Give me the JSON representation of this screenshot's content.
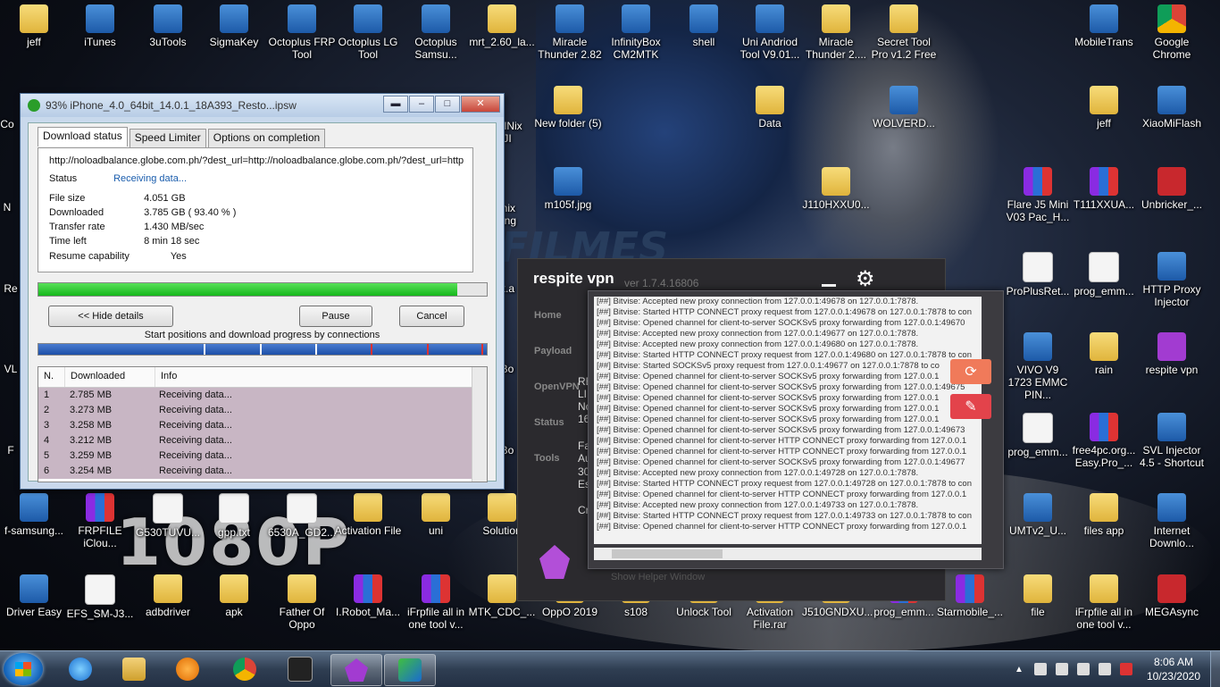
{
  "desktop": {
    "icons": [
      {
        "label": "jeff",
        "type": "folder"
      },
      {
        "label": "iTunes",
        "type": "app"
      },
      {
        "label": "3uTools",
        "type": "app"
      },
      {
        "label": "SigmaKey",
        "type": "app"
      },
      {
        "label": "Octoplus FRP Tool",
        "type": "app"
      },
      {
        "label": "Octoplus LG Tool",
        "type": "app"
      },
      {
        "label": "Octoplus Samsu...",
        "type": "app"
      },
      {
        "label": "mrt_2.60_la...",
        "type": "folder"
      },
      {
        "label": "Miracle Thunder 2.82",
        "type": "app"
      },
      {
        "label": "InfinityBox CM2MTK",
        "type": "app"
      },
      {
        "label": "shell",
        "type": "app"
      },
      {
        "label": "Uni Andriod Tool V9.01...",
        "type": "app"
      },
      {
        "label": "Miracle Thunder 2....",
        "type": "folder"
      },
      {
        "label": "Secret Tool Pro v1.2 Free",
        "type": "folder"
      },
      {
        "label": "MobileTrans",
        "type": "app"
      },
      {
        "label": "Google Chrome",
        "type": "chrome"
      },
      {
        "label": "New folder (5)",
        "type": "folder"
      },
      {
        "label": "Data",
        "type": "folder"
      },
      {
        "label": "WOLVERD...",
        "type": "app"
      },
      {
        "label": "jeff",
        "type": "folder"
      },
      {
        "label": "XiaoMiFlash",
        "type": "app"
      },
      {
        "label": "m105f.jpg",
        "type": "image"
      },
      {
        "label": "J110HXXU0...",
        "type": "folder"
      },
      {
        "label": "Flare J5 Mini V03 Pac_H...",
        "type": "rar"
      },
      {
        "label": "T111XXUA...",
        "type": "rar"
      },
      {
        "label": "Unbricker_...",
        "type": "red"
      },
      {
        "label": "ProPlusRet...",
        "type": "doc"
      },
      {
        "label": "prog_emm...",
        "type": "doc"
      },
      {
        "label": "HTTP Proxy Injector",
        "type": "app"
      },
      {
        "label": "VIVO V9 1723 EMMC PIN...",
        "type": "app"
      },
      {
        "label": "rain",
        "type": "folder"
      },
      {
        "label": "respite vpn",
        "type": "purple"
      },
      {
        "label": "prog_emm...",
        "type": "doc"
      },
      {
        "label": "free4pc.org... Easy.Pro_...",
        "type": "rar"
      },
      {
        "label": "SVL Injector 4.5 - Shortcut",
        "type": "app"
      },
      {
        "label": "f-samsung...",
        "type": "app"
      },
      {
        "label": "FRPFILE iClou...",
        "type": "rar"
      },
      {
        "label": "G530TUVU...",
        "type": "doc"
      },
      {
        "label": "gpp.txt",
        "type": "doc"
      },
      {
        "label": "6530A_GD2...",
        "type": "doc"
      },
      {
        "label": "Activation File",
        "type": "folder"
      },
      {
        "label": "uni",
        "type": "folder"
      },
      {
        "label": "Solution",
        "type": "folder"
      },
      {
        "label": "UMTv2_U...",
        "type": "app"
      },
      {
        "label": "files app",
        "type": "folder"
      },
      {
        "label": "Internet Downlo...",
        "type": "app"
      },
      {
        "label": "Driver Easy",
        "type": "app"
      },
      {
        "label": "EFS_SM-J3...",
        "type": "doc"
      },
      {
        "label": "adbdriver",
        "type": "folder"
      },
      {
        "label": "apk",
        "type": "folder"
      },
      {
        "label": "Father Of Oppo",
        "type": "folder"
      },
      {
        "label": "I.Robot_Ma...",
        "type": "rar"
      },
      {
        "label": "iFrpfile all in one tool v...",
        "type": "rar"
      },
      {
        "label": "MTK_CDC_...",
        "type": "folder"
      },
      {
        "label": "OppO 2019",
        "type": "folder"
      },
      {
        "label": "s108",
        "type": "folder"
      },
      {
        "label": "Unlock Tool",
        "type": "folder"
      },
      {
        "label": "Activation File.rar",
        "type": "folder"
      },
      {
        "label": "J510GNDXU...",
        "type": "folder"
      },
      {
        "label": "prog_emm...",
        "type": "rar"
      },
      {
        "label": "Starmobile_...",
        "type": "rar"
      },
      {
        "label": "file",
        "type": "folder"
      },
      {
        "label": "iFrpfile all in one tool v...",
        "type": "folder"
      },
      {
        "label": "MEGAsync",
        "type": "red"
      }
    ],
    "partial_labels": [
      "Co",
      "N",
      "Re",
      "VL",
      "F",
      "oolNix JI",
      "inix ang",
      "k.a",
      "Bo",
      "Bo"
    ]
  },
  "wallpaper": {
    "text1": "1080P",
    "text2": "FILMES"
  },
  "download_window": {
    "title": "93% iPhone_4.0_64bit_14.0.1_18A393_Resto...ipsw",
    "tabs": [
      "Download status",
      "Speed Limiter",
      "Options on completion"
    ],
    "url": "http://noloadbalance.globe.com.ph/?dest_url=http://noloadbalance.globe.com.ph/?dest_url=http",
    "status_label": "Status",
    "status_value": "Receiving data...",
    "file_size_label": "File size",
    "file_size": "4.051  GB",
    "downloaded_label": "Downloaded",
    "downloaded": "3.785  GB  ( 93.40 % )",
    "transfer_rate_label": "Transfer rate",
    "transfer_rate": "1.430  MB/sec",
    "time_left_label": "Time left",
    "time_left": "8 min 18 sec",
    "resume_label": "Resume capability",
    "resume": "Yes",
    "progress_percent": 93.4,
    "hide_details": "<< Hide details",
    "pause": "Pause",
    "cancel": "Cancel",
    "connections_label": "Start positions and download progress by connections",
    "columns": [
      "N.",
      "Downloaded",
      "Info"
    ],
    "rows": [
      {
        "n": "1",
        "dl": "2.785  MB",
        "info": "Receiving data..."
      },
      {
        "n": "2",
        "dl": "3.273  MB",
        "info": "Receiving data..."
      },
      {
        "n": "3",
        "dl": "3.258  MB",
        "info": "Receiving data..."
      },
      {
        "n": "4",
        "dl": "3.212  MB",
        "info": "Receiving data..."
      },
      {
        "n": "5",
        "dl": "3.259  MB",
        "info": "Receiving data..."
      },
      {
        "n": "6",
        "dl": "3.254  MB",
        "info": "Receiving data..."
      }
    ]
  },
  "vpn": {
    "title": "respite vpn",
    "version": "ver 1.7.4.16806",
    "nav": [
      "Home",
      "Payload",
      "OpenVPN",
      "Status",
      "Tools"
    ],
    "partial_text": [
      "RE",
      "LIF",
      "Nc",
      "16",
      "Fas",
      "Au",
      "30",
      "Est",
      "Cre"
    ],
    "helper": "Show Helper Window",
    "log_lines": [
      "[##] Bitvise: Accepted new proxy connection from 127.0.0.1:49678 on 127.0.0.1:7878.",
      "[##] Bitvise: Started HTTP CONNECT proxy request from 127.0.0.1:49678 on 127.0.0.1:7878 to con",
      "[##] Bitvise: Opened channel for client-to-server SOCKSv5 proxy forwarding from 127.0.0.1:49670",
      "[##] Bitvise: Accepted new proxy connection from 127.0.0.1:49677 on 127.0.0.1:7878.",
      "[##] Bitvise: Accepted new proxy connection from 127.0.0.1:49680 on 127.0.0.1:7878.",
      "[##] Bitvise: Started HTTP CONNECT proxy request from 127.0.0.1:49680 on 127.0.0.1:7878 to con",
      "[##] Bitvise: Started SOCKSv5 proxy request from 127.0.0.1:49677 on 127.0.0.1:7878 to co",
      "[##] Bitvise: Opened channel for client-to-server SOCKSv5 proxy forwarding from 127.0.0.1",
      "[##] Bitvise: Opened channel for client-to-server SOCKSv5 proxy forwarding from 127.0.0.1:49675",
      "[##] Bitvise: Opened channel for client-to-server SOCKSv5 proxy forwarding from 127.0.0.1",
      "[##] Bitvise: Opened channel for client-to-server SOCKSv5 proxy forwarding from 127.0.0.1",
      "[##] Bitvise: Opened channel for client-to-server SOCKSv5 proxy forwarding from 127.0.0.1",
      "[##] Bitvise: Opened channel for client-to-server SOCKSv5 proxy forwarding from 127.0.0.1:49673",
      "[##] Bitvise: Opened channel for client-to-server HTTP CONNECT proxy forwarding from 127.0.0.1",
      "[##] Bitvise: Opened channel for client-to-server HTTP CONNECT proxy forwarding from 127.0.0.1",
      "[##] Bitvise: Opened channel for client-to-server SOCKSv5 proxy forwarding from 127.0.0.1:49677",
      "[##] Bitvise: Accepted new proxy connection from 127.0.0.1:49728 on 127.0.0.1:7878.",
      "[##] Bitvise: Started HTTP CONNECT proxy request from 127.0.0.1:49728 on 127.0.0.1:7878 to con",
      "[##] Bitvise: Opened channel for client-to-server HTTP CONNECT proxy forwarding from 127.0.0.1",
      "[##] Bitvise: Accepted new proxy connection from 127.0.0.1:49733 on 127.0.0.1:7878.",
      "[##] Bitvise: Started HTTP CONNECT proxy request from 127.0.0.1:49733 on 127.0.0.1:7878 to con",
      "[##] Bitvise: Opened channel for client-to-server HTTP CONNECT proxy forwarding from 127.0.0.1"
    ]
  },
  "taskbar": {
    "time": "8:06 AM",
    "date": "10/23/2020"
  }
}
